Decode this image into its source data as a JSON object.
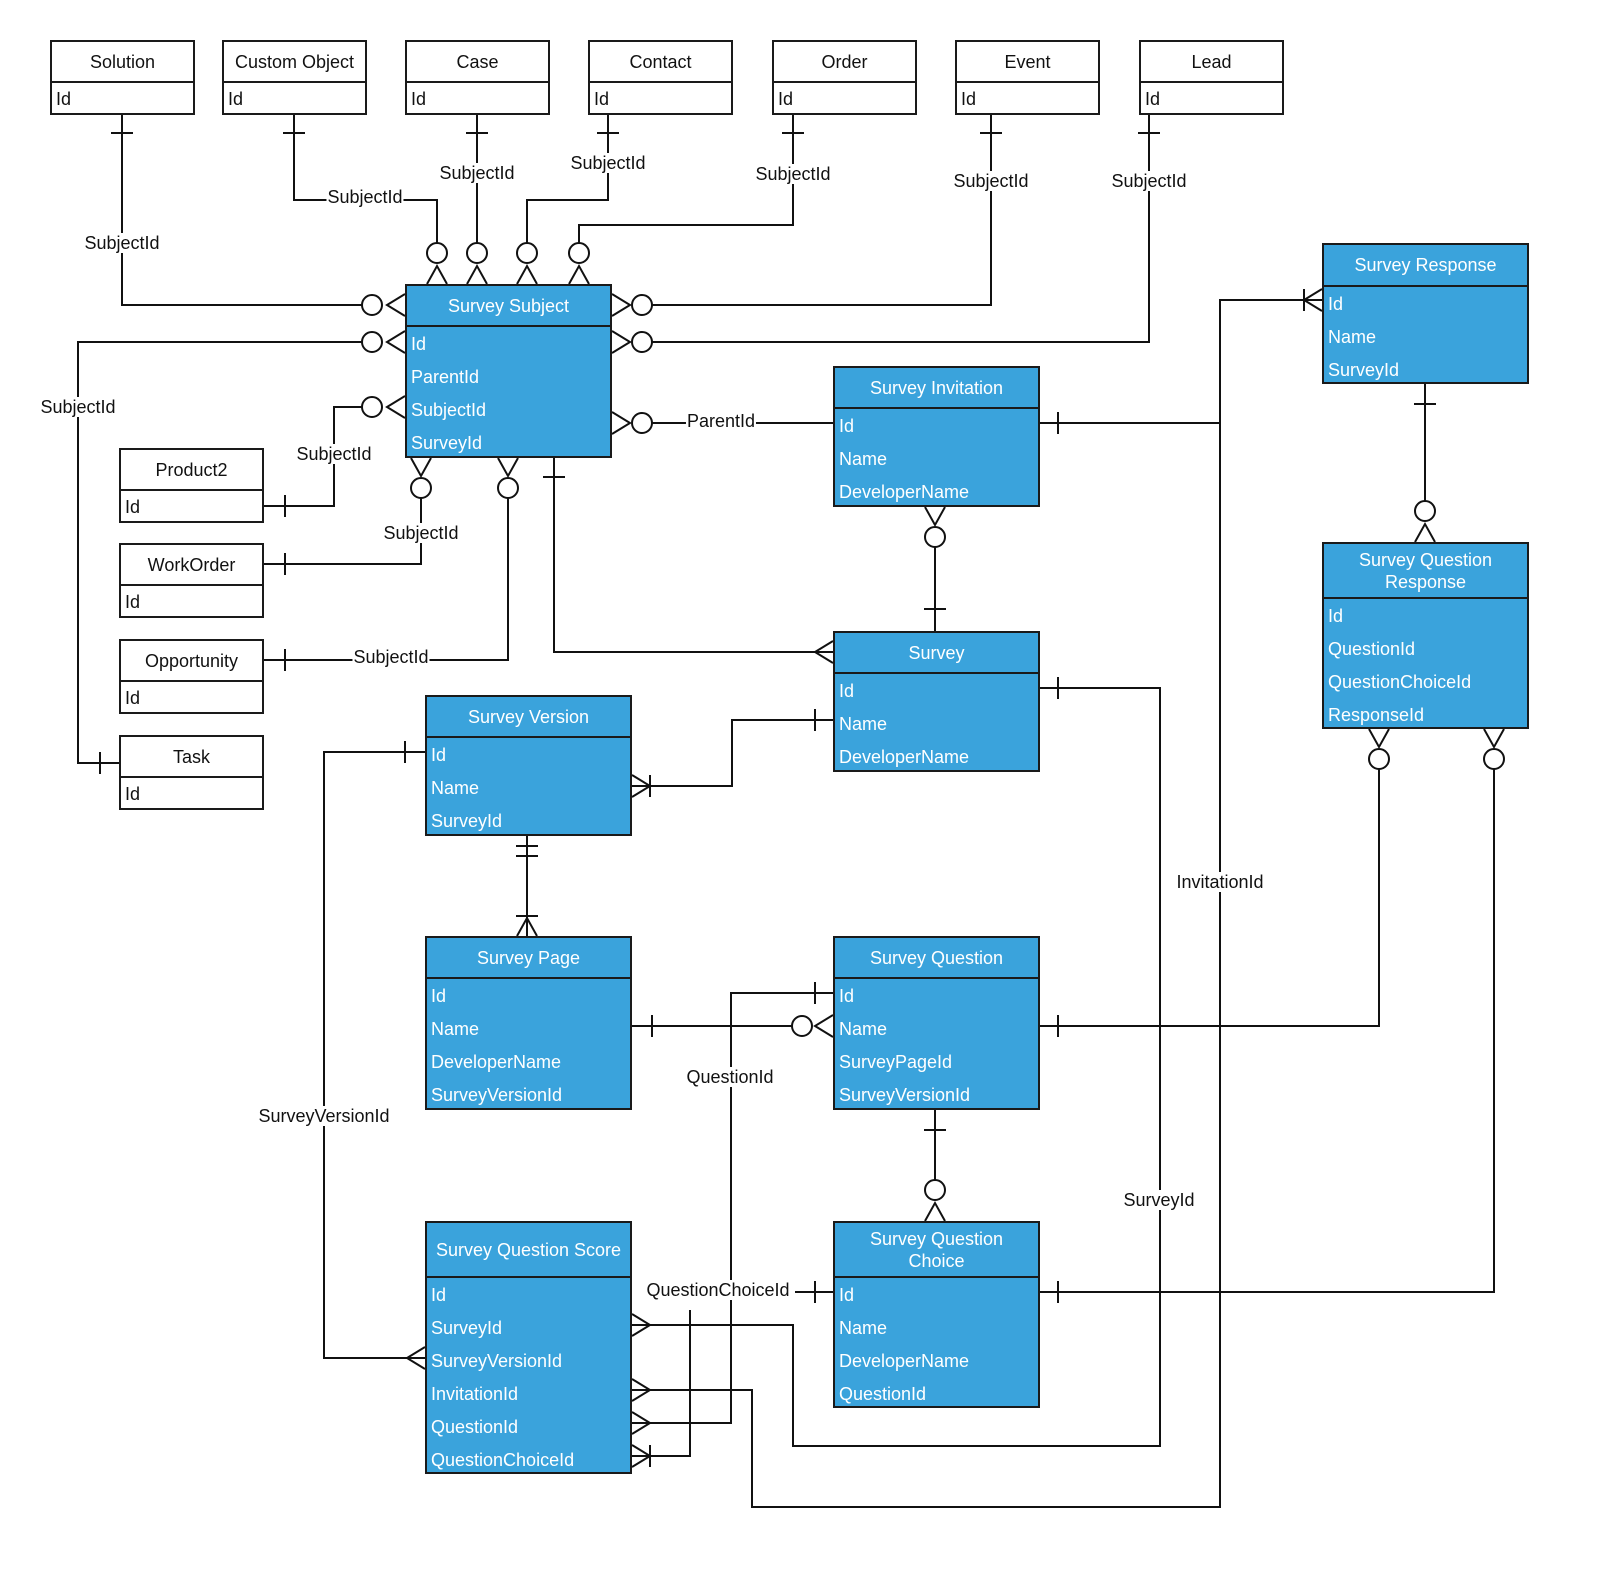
{
  "diagram": {
    "type": "entity-relationship",
    "entities": [
      {
        "id": "solution",
        "title": "Solution",
        "style": "white",
        "fields": [
          "Id"
        ]
      },
      {
        "id": "custom_object",
        "title": "Custom Object",
        "style": "white",
        "fields": [
          "Id"
        ]
      },
      {
        "id": "case",
        "title": "Case",
        "style": "white",
        "fields": [
          "Id"
        ]
      },
      {
        "id": "contact",
        "title": "Contact",
        "style": "white",
        "fields": [
          "Id"
        ]
      },
      {
        "id": "order",
        "title": "Order",
        "style": "white",
        "fields": [
          "Id"
        ]
      },
      {
        "id": "event",
        "title": "Event",
        "style": "white",
        "fields": [
          "Id"
        ]
      },
      {
        "id": "lead",
        "title": "Lead",
        "style": "white",
        "fields": [
          "Id"
        ]
      },
      {
        "id": "product2",
        "title": "Product2",
        "style": "white",
        "fields": [
          "Id"
        ]
      },
      {
        "id": "workorder",
        "title": "WorkOrder",
        "style": "white",
        "fields": [
          "Id"
        ]
      },
      {
        "id": "opportunity",
        "title": "Opportunity",
        "style": "white",
        "fields": [
          "Id"
        ]
      },
      {
        "id": "task",
        "title": "Task",
        "style": "white",
        "fields": [
          "Id"
        ]
      },
      {
        "id": "survey_subject",
        "title": "Survey Subject",
        "style": "blue",
        "fields": [
          "Id",
          "ParentId",
          "SubjectId",
          "SurveyId"
        ]
      },
      {
        "id": "survey_response",
        "title": "Survey Response",
        "style": "blue",
        "fields": [
          "Id",
          "Name",
          "SurveyId"
        ]
      },
      {
        "id": "survey_invitation",
        "title": "Survey Invitation",
        "style": "blue",
        "fields": [
          "Id",
          "Name",
          "DeveloperName"
        ]
      },
      {
        "id": "survey_question_response",
        "title": "Survey Question Response",
        "style": "blue",
        "fields": [
          "Id",
          "QuestionId",
          "QuestionChoiceId",
          "ResponseId"
        ]
      },
      {
        "id": "survey",
        "title": "Survey",
        "style": "blue",
        "fields": [
          "Id",
          "Name",
          "DeveloperName"
        ]
      },
      {
        "id": "survey_version",
        "title": "Survey Version",
        "style": "blue",
        "fields": [
          "Id",
          "Name",
          "SurveyId"
        ]
      },
      {
        "id": "survey_page",
        "title": "Survey Page",
        "style": "blue",
        "fields": [
          "Id",
          "Name",
          "DeveloperName",
          "SurveyVersionId"
        ]
      },
      {
        "id": "survey_question",
        "title": "Survey Question",
        "style": "blue",
        "fields": [
          "Id",
          "Name",
          "SurveyPageId",
          "SurveyVersionId"
        ]
      },
      {
        "id": "survey_question_score",
        "title": "Survey Question Score",
        "style": "blue",
        "fields": [
          "Id",
          "SurveyId",
          "SurveyVersionId",
          "InvitationId",
          "QuestionId",
          "QuestionChoiceId"
        ]
      },
      {
        "id": "survey_question_choice",
        "title": "Survey Question Choice",
        "style": "blue",
        "fields": [
          "Id",
          "Name",
          "DeveloperName",
          "QuestionId"
        ]
      }
    ],
    "relationships": [
      {
        "from": "solution",
        "to": "survey_subject",
        "label": "SubjectId",
        "from_card": "one",
        "to_card": "zero-or-many"
      },
      {
        "from": "custom_object",
        "to": "survey_subject",
        "label": "SubjectId",
        "from_card": "one",
        "to_card": "zero-or-many"
      },
      {
        "from": "case",
        "to": "survey_subject",
        "label": "SubjectId",
        "from_card": "one",
        "to_card": "zero-or-many"
      },
      {
        "from": "contact",
        "to": "survey_subject",
        "label": "SubjectId",
        "from_card": "one",
        "to_card": "zero-or-many"
      },
      {
        "from": "order",
        "to": "survey_subject",
        "label": "SubjectId",
        "from_card": "one",
        "to_card": "zero-or-many"
      },
      {
        "from": "event",
        "to": "survey_subject",
        "label": "SubjectId",
        "from_card": "one",
        "to_card": "zero-or-many"
      },
      {
        "from": "lead",
        "to": "survey_subject",
        "label": "SubjectId",
        "from_card": "one",
        "to_card": "zero-or-many"
      },
      {
        "from": "task",
        "to": "survey_subject",
        "label": "SubjectId",
        "from_card": "one",
        "to_card": "zero-or-many"
      },
      {
        "from": "product2",
        "to": "survey_subject",
        "label": "SubjectId",
        "from_card": "one",
        "to_card": "zero-or-many"
      },
      {
        "from": "workorder",
        "to": "survey_subject",
        "label": "SubjectId",
        "from_card": "one",
        "to_card": "zero-or-many"
      },
      {
        "from": "opportunity",
        "to": "survey_subject",
        "label": "SubjectId",
        "from_card": "one",
        "to_card": "zero-or-many"
      },
      {
        "from": "survey_invitation",
        "to": "survey_subject",
        "label": "ParentId",
        "from_card": "one",
        "to_card": "zero-or-many"
      },
      {
        "from": "survey_subject",
        "to": "survey",
        "label": "",
        "from_card": "one",
        "to_card": "many"
      },
      {
        "from": "survey_invitation",
        "to": "survey_response",
        "label": "",
        "from_card": "one",
        "to_card": "one-or-many"
      },
      {
        "from": "survey_response",
        "to": "survey_question_response",
        "label": "",
        "from_card": "one",
        "to_card": "zero-or-many"
      },
      {
        "from": "survey",
        "to": "survey_invitation",
        "label": "",
        "from_card": "one",
        "to_card": "zero-or-many"
      },
      {
        "from": "survey",
        "to": "survey_version",
        "label": "",
        "from_card": "one",
        "to_card": "one-or-many"
      },
      {
        "from": "survey_version",
        "to": "survey_page",
        "label": "",
        "from_card": "one-and-only-one",
        "to_card": "one-or-many"
      },
      {
        "from": "survey_page",
        "to": "survey_question",
        "label": "",
        "from_card": "one",
        "to_card": "zero-or-many"
      },
      {
        "from": "survey_question",
        "to": "survey_question_choice",
        "label": "",
        "from_card": "one",
        "to_card": "zero-or-many"
      },
      {
        "from": "survey_question",
        "to": "survey_question_response",
        "label": "",
        "from_card": "one",
        "to_card": "zero-or-many"
      },
      {
        "from": "survey_question_choice",
        "to": "survey_question_response",
        "label": "",
        "from_card": "one",
        "to_card": "zero-or-many"
      },
      {
        "from": "survey_version",
        "to": "survey_question_score",
        "label": "SurveyVersionId",
        "from_card": "one",
        "to_card": "many"
      },
      {
        "from": "survey",
        "to": "survey_question_score",
        "label": "SurveyId",
        "from_card": "one",
        "to_card": "many"
      },
      {
        "from": "survey_invitation",
        "to": "survey_question_score",
        "label": "InvitationId",
        "from_card": "one",
        "to_card": "many"
      },
      {
        "from": "survey_question",
        "to": "survey_question_score",
        "label": "QuestionId",
        "from_card": "one",
        "to_card": "many"
      },
      {
        "from": "survey_question_choice",
        "to": "survey_question_score",
        "label": "QuestionChoiceId",
        "from_card": "one",
        "to_card": "one-or-many"
      }
    ],
    "labels": {
      "subject_solution": "SubjectId",
      "subject_custom": "SubjectId",
      "subject_case": "SubjectId",
      "subject_contact": "SubjectId",
      "subject_order": "SubjectId",
      "subject_event": "SubjectId",
      "subject_lead": "SubjectId",
      "subject_task": "SubjectId",
      "subject_product2": "SubjectId",
      "subject_workorder": "SubjectId",
      "subject_opportunity": "SubjectId",
      "parent_id": "ParentId",
      "invitation_id": "InvitationId",
      "survey_id": "SurveyId",
      "survey_version_id": "SurveyVersionId",
      "question_id": "QuestionId",
      "question_choice_id": "QuestionChoiceId"
    }
  }
}
